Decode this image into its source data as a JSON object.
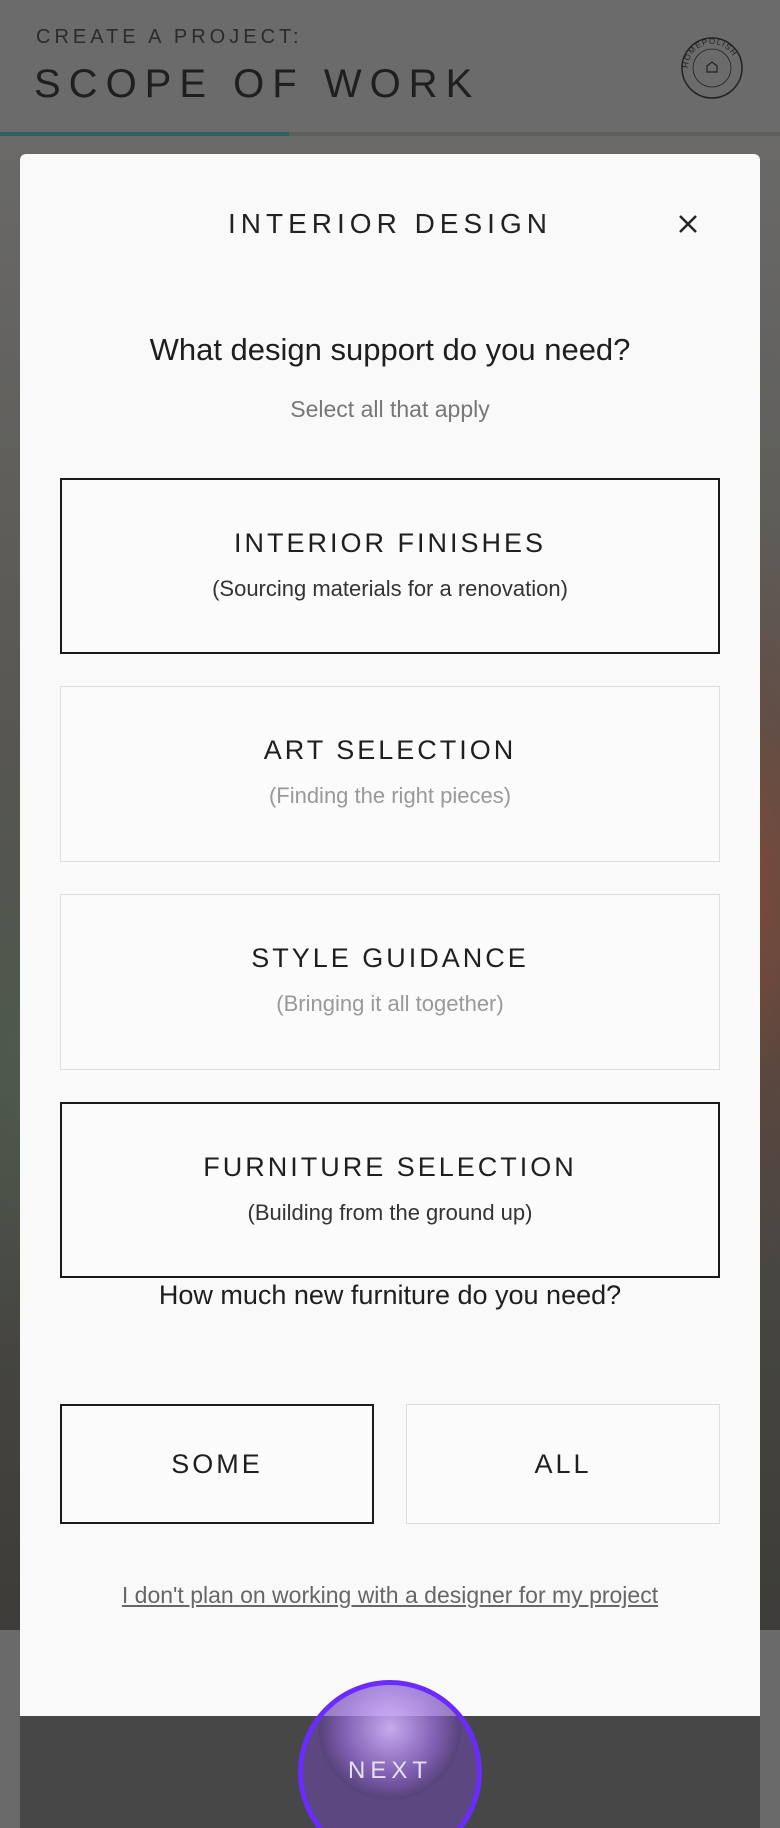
{
  "header": {
    "eyebrow": "CREATE A PROJECT:",
    "title": "SCOPE OF WORK",
    "logo_text": "HOMEPOLISH",
    "progress": 0.37
  },
  "modal": {
    "title": "INTERIOR DESIGN",
    "close_icon": "close-icon",
    "question": "What design support do you need?",
    "hint": "Select all that apply",
    "options": [
      {
        "title": "INTERIOR FINISHES",
        "subtitle": "(Sourcing materials for a renovation)",
        "selected": true
      },
      {
        "title": "ART SELECTION",
        "subtitle": "(Finding the right pieces)",
        "selected": false
      },
      {
        "title": "STYLE GUIDANCE",
        "subtitle": "(Bringing it all together)",
        "selected": false
      },
      {
        "title": "FURNITURE SELECTION",
        "subtitle": "(Building from the ground up)",
        "selected": true
      }
    ],
    "furniture_question": "How much new furniture do you need?",
    "furniture_options": [
      {
        "label": "SOME",
        "selected": true
      },
      {
        "label": "ALL",
        "selected": false
      }
    ],
    "skip_link": "I don't plan on working with a designer for my project"
  },
  "footer": {
    "next_label": "NEXT"
  },
  "colors": {
    "accent": "#6a2bff",
    "progress": "#2e6060"
  }
}
